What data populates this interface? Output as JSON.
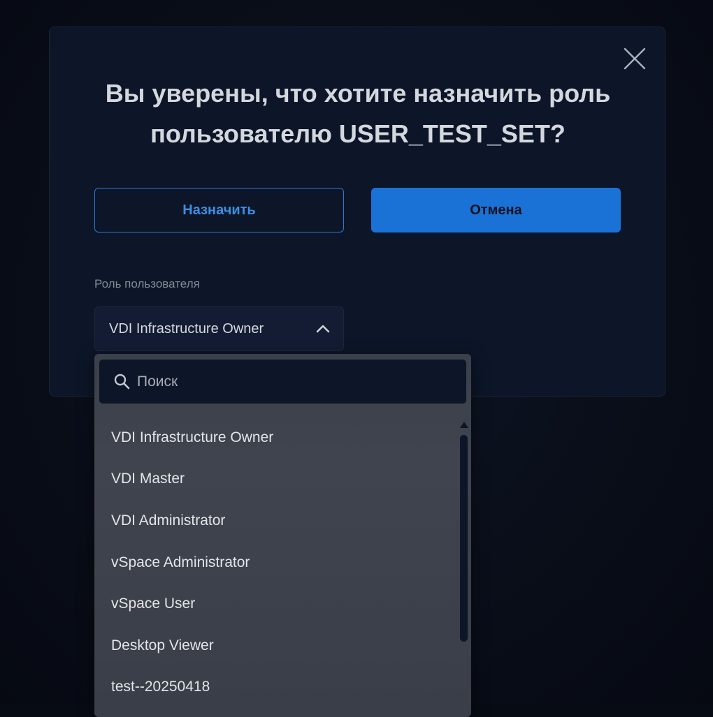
{
  "dialog": {
    "title": "Вы уверены, что хотите назначить роль пользователю USER_TEST_SET?",
    "assign_label": "Назначить",
    "cancel_label": "Отмена",
    "close_icon": "close-icon"
  },
  "role_field": {
    "label": "Роль пользователя",
    "selected_value": "VDI Infrastructure Owner",
    "toggle_icon": "chevron-up-icon"
  },
  "dropdown": {
    "search_placeholder": "Поиск",
    "search_value": "",
    "options": [
      "VDI Infrastructure Owner",
      "VDI Master",
      "VDI Administrator",
      "vSpace Administrator",
      "vSpace User",
      "Desktop Viewer",
      "test--20250418"
    ]
  },
  "colors": {
    "accent": "#1a72d6",
    "dialog_bg": "#0c1628",
    "dropdown_bg": "#3e424c"
  }
}
